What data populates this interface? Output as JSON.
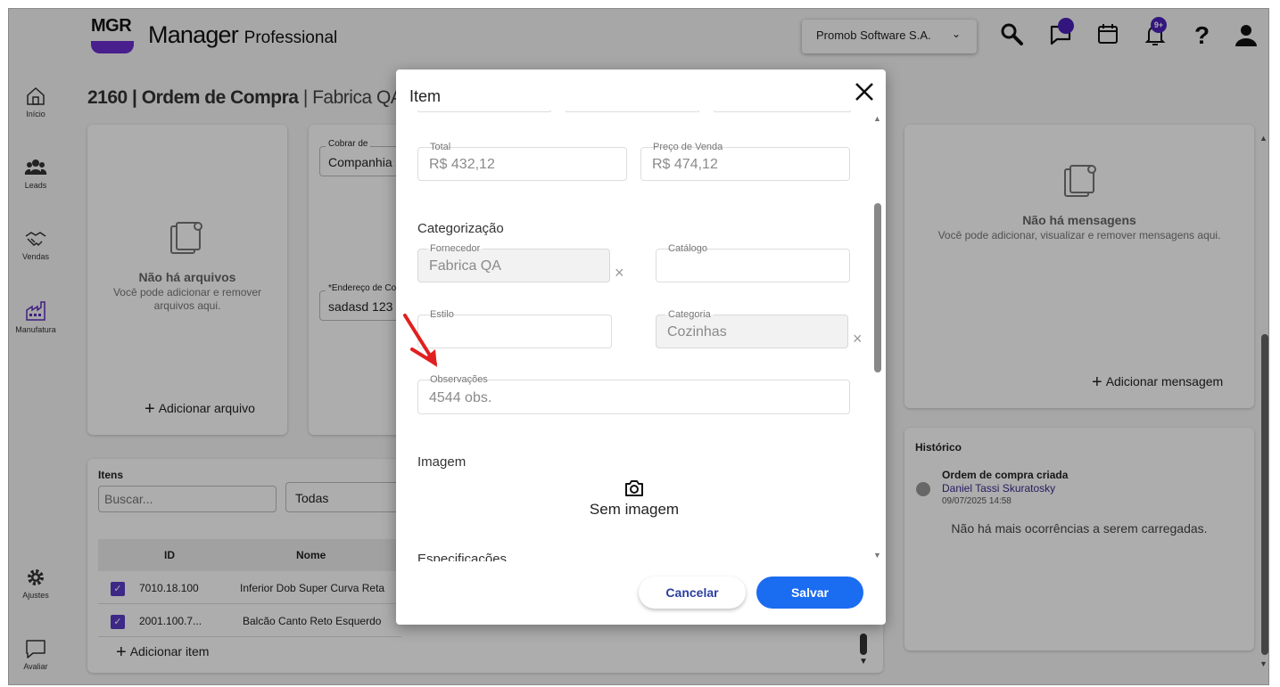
{
  "header": {
    "logo_text": "MGR",
    "brand_main": "Manager",
    "brand_sub": "Professional",
    "company_selector": "Promob Software S.A.",
    "notification_badge": "9+",
    "accent_color": "#4a1fb8"
  },
  "sidebar": {
    "items": [
      {
        "label": "Início",
        "icon": "home-icon"
      },
      {
        "label": "Leads",
        "icon": "users-icon"
      },
      {
        "label": "Vendas",
        "icon": "handshake-icon"
      },
      {
        "label": "Manufatura",
        "icon": "factory-icon"
      },
      {
        "label": "Ajustes",
        "icon": "gear-icon"
      },
      {
        "label": "Avaliar",
        "icon": "chat-icon"
      }
    ]
  },
  "page": {
    "title_bold": "2160 | Ordem de Compra",
    "title_light": "| Fabrica QA",
    "files": {
      "empty_title": "Não há arquivos",
      "empty_sub_line1": "Você pode adicionar e remover",
      "empty_sub_line2": "arquivos aqui.",
      "add_label": "Adicionar arquivo"
    },
    "billing": {
      "charge_label": "Cobrar de",
      "charge_value": "Companhia",
      "address_label": "*Endereço de Co",
      "address_value": "sadasd 123"
    },
    "messages": {
      "empty_title": "Não há mensagens",
      "empty_sub": "Você pode adicionar, visualizar e remover mensagens aqui.",
      "add_label": "Adicionar mensagem"
    },
    "history": {
      "title": "Histórico",
      "event_title": "Ordem de compra criada",
      "event_user": "Daniel Tassi Skuratosky",
      "event_time": "09/07/2025 14:58",
      "no_more": "Não há mais ocorrências a serem carregadas."
    },
    "items": {
      "title": "Itens",
      "search_placeholder": "Buscar...",
      "filter_value": "Todas",
      "columns": [
        "ID",
        "Nome"
      ],
      "rows": [
        {
          "id": "7010.18.100",
          "name": "Inferior Dob Super Curva Reta"
        },
        {
          "id": "2001.100.7...",
          "name": "Balcão Canto Reto Esquerdo"
        }
      ],
      "add_label": "Adicionar item"
    }
  },
  "modal": {
    "title": "Item",
    "total_label": "Total",
    "total_value": "R$ 432,12",
    "price_label": "Preço de Venda",
    "price_value": "R$ 474,12",
    "categorization_title": "Categorização",
    "supplier_label": "Fornecedor",
    "supplier_value": "Fabrica QA",
    "catalog_label": "Catálogo",
    "style_label": "Estilo",
    "category_label": "Categoria",
    "category_value": "Cozinhas",
    "notes_label": "Observações",
    "notes_value": "4544 obs.",
    "image_title": "Imagem",
    "no_image": "Sem imagem",
    "specs_title": "Especificações",
    "cancel_label": "Cancelar",
    "save_label": "Salvar",
    "save_color": "#1a6cf0",
    "annotation_color": "#e02020"
  }
}
